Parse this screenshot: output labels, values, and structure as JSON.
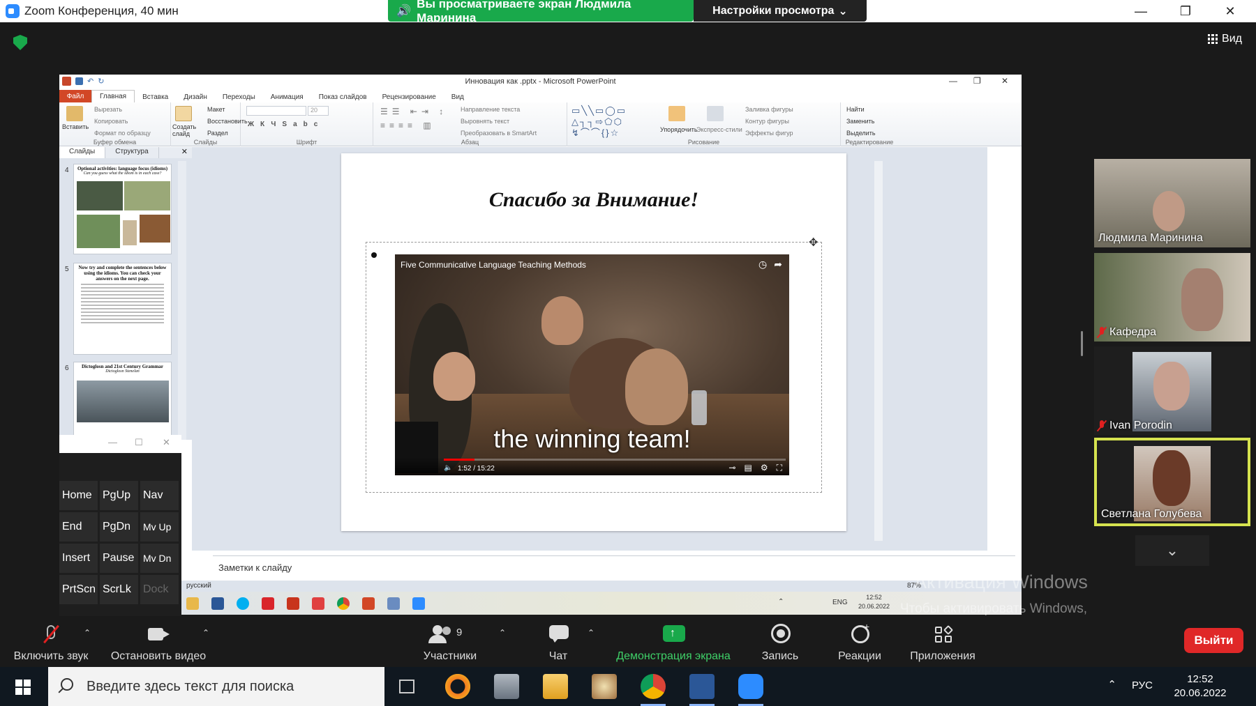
{
  "zoom": {
    "title": "Zoom Конференция, 40 мин",
    "share_banner": "Вы просматриваете экран Людмила Маринина",
    "view_options": "Настройки просмотра",
    "view_label": "Вид",
    "leave": "Выйти"
  },
  "toolbar": {
    "unmute": "Включить звук",
    "stop_video": "Остановить видео",
    "participants": "Участники",
    "participants_count": "9",
    "chat": "Чат",
    "share": "Демонстрация экрана",
    "record": "Запись",
    "reactions": "Реакции",
    "apps": "Приложения"
  },
  "participants": [
    {
      "name": "Людмила Маринина",
      "muted": false
    },
    {
      "name": "Кафедра",
      "muted": true
    },
    {
      "name": "Ivan Porodin",
      "muted": true
    },
    {
      "name": "Светлана Голубева",
      "muted": false
    }
  ],
  "powerpoint": {
    "title": "Инновация как .pptx - Microsoft PowerPoint",
    "tabs": [
      "Файл",
      "Главная",
      "Вставка",
      "Дизайн",
      "Переходы",
      "Анимация",
      "Показ слайдов",
      "Рецензирование",
      "Вид"
    ],
    "ribbon": {
      "paste": "Вставить",
      "cut": "Вырезать",
      "copy": "Копировать",
      "format_painter": "Формат по образцу",
      "clipboard_group": "Буфер обмена",
      "new_slide": "Создать слайд",
      "layout": "Макет",
      "reset": "Восстановить",
      "section": "Раздел",
      "slides_group": "Слайды",
      "font_size": "20",
      "font_group": "Шрифт",
      "text_direction": "Направление текста",
      "align_text": "Выровнять текст",
      "smartart": "Преобразовать в SmartArt",
      "paragraph_group": "Абзац",
      "arrange": "Упорядочить",
      "quick_styles": "Экспресс-стили",
      "shape_fill": "Заливка фигуры",
      "shape_outline": "Контур фигуры",
      "shape_effects": "Эффекты фигур",
      "drawing_group": "Рисование",
      "find": "Найти",
      "replace": "Заменить",
      "select": "Выделить",
      "editing_group": "Редактирование"
    },
    "panel_tabs": [
      "Слайды",
      "Структура"
    ],
    "thumbnails": [
      {
        "num": "4",
        "title": "Optional activities: language focus (idioms)",
        "subtitle": "Can you guess what the idiom is in each case?"
      },
      {
        "num": "5",
        "title": "Now try and complete the sentences below using the idioms. You can check your answers on the next page."
      },
      {
        "num": "6",
        "title": "Dictoglosn and 21st Century Grammar",
        "subtitle": "Dictoglosn Stenelan"
      }
    ],
    "slide": {
      "title": "Спасибо за Внимание!",
      "video_title": "Five Communicative Language Teaching Methods",
      "caption": "the winning team!",
      "time": "1:52 / 15:22"
    },
    "notes_placeholder": "Заметки к слайду",
    "status_lang": "русский",
    "zoom_level": "87%",
    "inner_clock_time": "12:52",
    "inner_clock_date": "20.06.2022",
    "inner_lang": "ENG"
  },
  "osk": {
    "keys": [
      [
        "Home",
        "PgUp",
        "Nav"
      ],
      [
        "End",
        "PgDn",
        "Mv Up"
      ],
      [
        "Insert",
        "Pause",
        "Mv Dn"
      ],
      [
        "PrtScn",
        "ScrLk",
        "Dock"
      ]
    ]
  },
  "windows": {
    "activation_title": "Активация Windows",
    "activation_text": "Чтобы активировать Windows, перейдите в раздел \"Параметры\".",
    "search_placeholder": "Введите здесь текст для поиска",
    "lang": "РУС",
    "time": "12:52",
    "date": "20.06.2022"
  }
}
